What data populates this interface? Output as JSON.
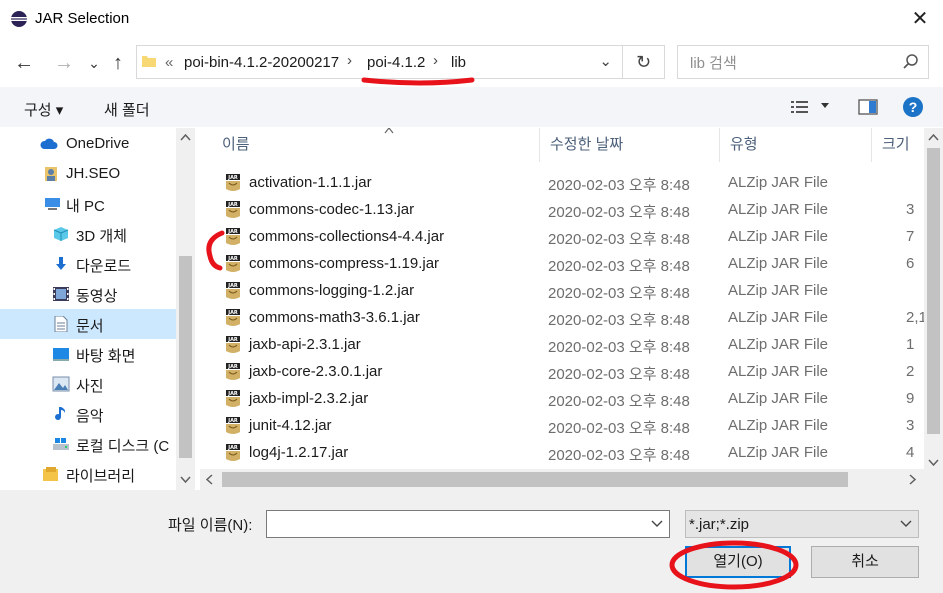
{
  "window": {
    "title": "JAR Selection",
    "close_glyph": "✕"
  },
  "nav": {
    "back_glyph": "←",
    "forward_glyph": "→",
    "recent_glyph": "⌄",
    "up_glyph": "↑",
    "refresh_glyph": "↻"
  },
  "address": {
    "overflow": "«",
    "crumbs": [
      "poi-bin-4.1.2-20200217",
      "poi-4.1.2",
      "lib"
    ],
    "separator": "›",
    "dropdown_glyph": "⌄"
  },
  "search": {
    "placeholder": "lib 검색"
  },
  "toolbar": {
    "organize_label": "구성 ▾",
    "new_folder_label": "새 폴더",
    "help_label": "?"
  },
  "sidebar": {
    "items": [
      {
        "label": "OneDrive",
        "icon": "cloud-icon"
      },
      {
        "label": "JH.SEO",
        "icon": "user-icon"
      },
      {
        "label": "내 PC",
        "icon": "pc-icon"
      },
      {
        "label": "3D 개체",
        "icon": "cube-icon"
      },
      {
        "label": "다운로드",
        "icon": "download-icon"
      },
      {
        "label": "동영상",
        "icon": "video-icon"
      },
      {
        "label": "문서",
        "icon": "document-icon",
        "selected": true
      },
      {
        "label": "바탕 화면",
        "icon": "desktop-icon"
      },
      {
        "label": "사진",
        "icon": "pictures-icon"
      },
      {
        "label": "음악",
        "icon": "music-icon"
      },
      {
        "label": "로컬 디스크 (C",
        "icon": "disk-icon"
      },
      {
        "label": "라이브러리",
        "icon": "library-icon"
      }
    ]
  },
  "columns": {
    "name": "이름",
    "date": "수정한 날짜",
    "type": "유형",
    "size": "크기"
  },
  "files": [
    {
      "name": "activation-1.1.1.jar",
      "date": "2020-02-03 오후 8:48",
      "type": "ALZip JAR File",
      "size": ""
    },
    {
      "name": "commons-codec-1.13.jar",
      "date": "2020-02-03 오후 8:48",
      "type": "ALZip JAR File",
      "size": "3"
    },
    {
      "name": "commons-collections4-4.4.jar",
      "date": "2020-02-03 오후 8:48",
      "type": "ALZip JAR File",
      "size": "7"
    },
    {
      "name": "commons-compress-1.19.jar",
      "date": "2020-02-03 오후 8:48",
      "type": "ALZip JAR File",
      "size": "6"
    },
    {
      "name": "commons-logging-1.2.jar",
      "date": "2020-02-03 오후 8:48",
      "type": "ALZip JAR File",
      "size": ""
    },
    {
      "name": "commons-math3-3.6.1.jar",
      "date": "2020-02-03 오후 8:48",
      "type": "ALZip JAR File",
      "size": "2,1"
    },
    {
      "name": "jaxb-api-2.3.1.jar",
      "date": "2020-02-03 오후 8:48",
      "type": "ALZip JAR File",
      "size": "1"
    },
    {
      "name": "jaxb-core-2.3.0.1.jar",
      "date": "2020-02-03 오후 8:48",
      "type": "ALZip JAR File",
      "size": "2"
    },
    {
      "name": "jaxb-impl-2.3.2.jar",
      "date": "2020-02-03 오후 8:48",
      "type": "ALZip JAR File",
      "size": "9"
    },
    {
      "name": "junit-4.12.jar",
      "date": "2020-02-03 오후 8:48",
      "type": "ALZip JAR File",
      "size": "3"
    },
    {
      "name": "log4j-1.2.17.jar",
      "date": "2020-02-03 오후 8:48",
      "type": "ALZip JAR File",
      "size": "4"
    }
  ],
  "footer": {
    "filename_label": "파일 이름(N):",
    "filename_value": "",
    "filter_value": "*.jar;*.zip",
    "open_label": "열기(O)",
    "cancel_label": "취소"
  },
  "colors": {
    "accent": "#0078d7",
    "selected_bg": "#cce8ff",
    "annotation": "#e8121b"
  }
}
